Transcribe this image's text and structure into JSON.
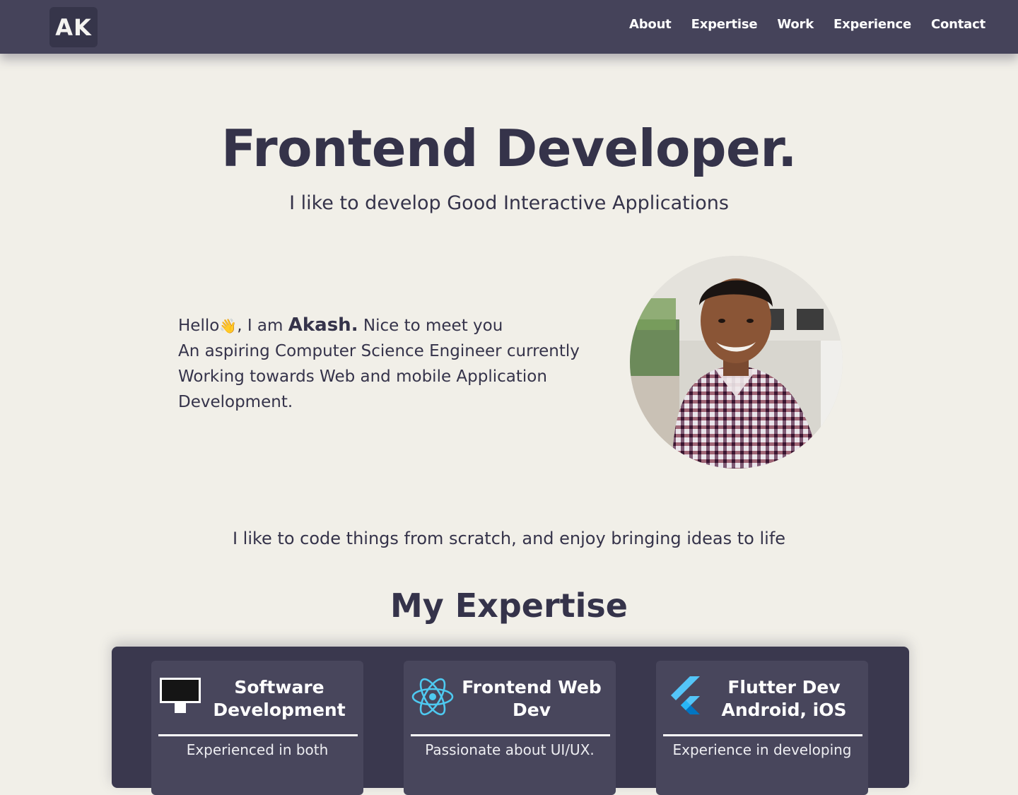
{
  "nav": {
    "logo": "AK",
    "links": [
      "About",
      "Expertise",
      "Work",
      "Experience",
      "Contact"
    ]
  },
  "hero": {
    "title": "Frontend Developer.",
    "subtitle": "I like to develop Good Interactive Applications"
  },
  "about": {
    "greeting": "Hello",
    "wave_icon": "👋",
    "iam": ", I am ",
    "name": "Akash.",
    "nice": " Nice to meet you",
    "line2": "An aspiring Computer Science Engineer currently Working towards Web and mobile Application Development.",
    "avatar_icon": "profile-photo"
  },
  "tagline": "I like to code things from scratch, and enjoy bringing ideas to life",
  "expertise": {
    "title": "My Expertise",
    "cards": [
      {
        "icon": "monitor-icon",
        "title": "Software Development",
        "text": "Experienced in both"
      },
      {
        "icon": "react-icon",
        "title": "Frontend Web Dev",
        "text": "Passionate about UI/UX."
      },
      {
        "icon": "flutter-icon",
        "title": "Flutter Dev Android, iOS",
        "text": "Experience in developing"
      }
    ]
  },
  "colors": {
    "nav_bg": "#45435a",
    "page_bg": "#f1efe8",
    "text": "#35334a",
    "panel_bg": "#3a384e",
    "card_bg": "#48465c",
    "react": "#4ec9f0",
    "flutter_light": "#54c5f8",
    "flutter_dark": "#0175c2"
  }
}
